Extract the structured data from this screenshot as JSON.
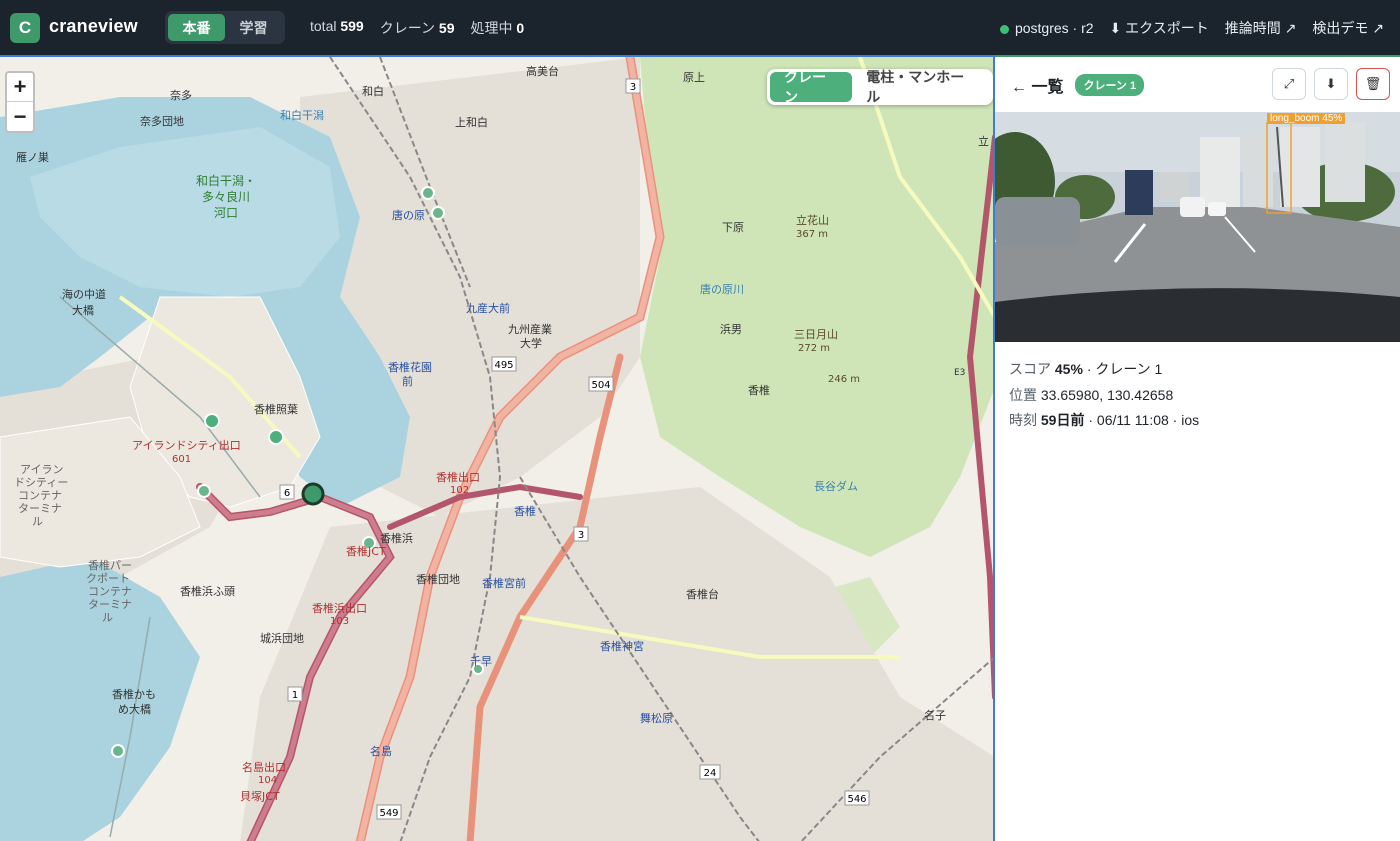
{
  "app": {
    "logo_letter": "C",
    "name": "craneview"
  },
  "env_toggle": {
    "options": [
      "本番",
      "学習"
    ],
    "active": "本番"
  },
  "stats": {
    "total_label": "total",
    "total": "599",
    "crane_label": "クレーン",
    "crane": "59",
    "processing_label": "処理中",
    "processing": "0"
  },
  "top_links": {
    "db": "postgres · r2",
    "export": "⬇ エクスポート",
    "inference": "推論時間 ↗",
    "demo": "検出デモ ↗"
  },
  "map": {
    "zoom_in": "+",
    "zoom_out": "−",
    "layers": [
      "クレーン",
      "電柱・マンホール"
    ],
    "active_layer": "クレーン",
    "labels": {
      "l1": "高美台",
      "l2": "原上",
      "l3": "和白",
      "l4": "奈多",
      "l5": "奈多団地",
      "l6": "和白干潟",
      "l7": "上和白",
      "l8": "雁ノ巣",
      "l9": "和白干潟・",
      "l10": "多々良川",
      "l11": "河口",
      "l12": "唐の原",
      "l13": "下原",
      "l14": "立花山",
      "l15": "367 m",
      "l16": "海の中道",
      "l17": "大橋",
      "l18": "九産大前",
      "l19": "九州産業",
      "l20": "大学",
      "l21": "浜男",
      "l22": "三日月山",
      "l23": "272 m",
      "l24": "香椎花園",
      "l25": "前",
      "l26": "香椎",
      "l27": "246 m",
      "l28": "香椎照葉",
      "l29": "アイランドシティ出口",
      "l30": "601",
      "l31": "アイラン",
      "l32": "ドシティー",
      "l33": "コンテナ",
      "l34": "ターミナ",
      "l35": "ル",
      "l36": "香椎出口",
      "l37": "102",
      "l38": "香椎浜",
      "l39": "香椎JCT",
      "l40": "香椎団地",
      "l41": "香椎宮前",
      "l42": "香椎台",
      "l43": "香椎パー",
      "l44": "クポート",
      "l45": "コンテナ",
      "l46": "ターミナ",
      "l47": "ル",
      "l48": "香椎浜ふ頭",
      "l49": "香椎浜出口",
      "l50": "103",
      "l51": "城浜団地",
      "l52": "香椎神宮",
      "l53": "香椎かも",
      "l54": "め大橋",
      "l55": "舞松原",
      "l56": "名子",
      "l57": "名島出口",
      "l58": "104",
      "l59": "貝塚JCT",
      "l60": "名島",
      "l61": "唐の原川",
      "l62": "長谷ダム",
      "l63": "香椎",
      "l64": "千早",
      "l65": "立",
      "l66": "E3"
    },
    "route_shields": {
      "r1": "3",
      "r2": "495",
      "r3": "504",
      "r4": "3",
      "r5": "6",
      "r6": "1",
      "r7": "549",
      "r8": "24",
      "r9": "546"
    }
  },
  "panel": {
    "back": "← 一覧",
    "badge": "クレーン 1",
    "expand_icon": "⤢",
    "download_icon": "⬇",
    "delete_icon": "🗑",
    "detection_label": "long_boom 45%",
    "score_key": "スコア",
    "score_value": "45%",
    "score_suffix": "· クレーン 1",
    "position_key": "位置",
    "position_value": "33.65980, 130.42658",
    "time_key": "時刻",
    "time_value": "59日前",
    "time_suffix": "· 06/11 11:08 · ios"
  },
  "colors": {
    "accent": "#3f9a6b",
    "badge": "#4caf7c",
    "detection_box": "#f0a030",
    "selection_border": "#3d7bd9"
  }
}
